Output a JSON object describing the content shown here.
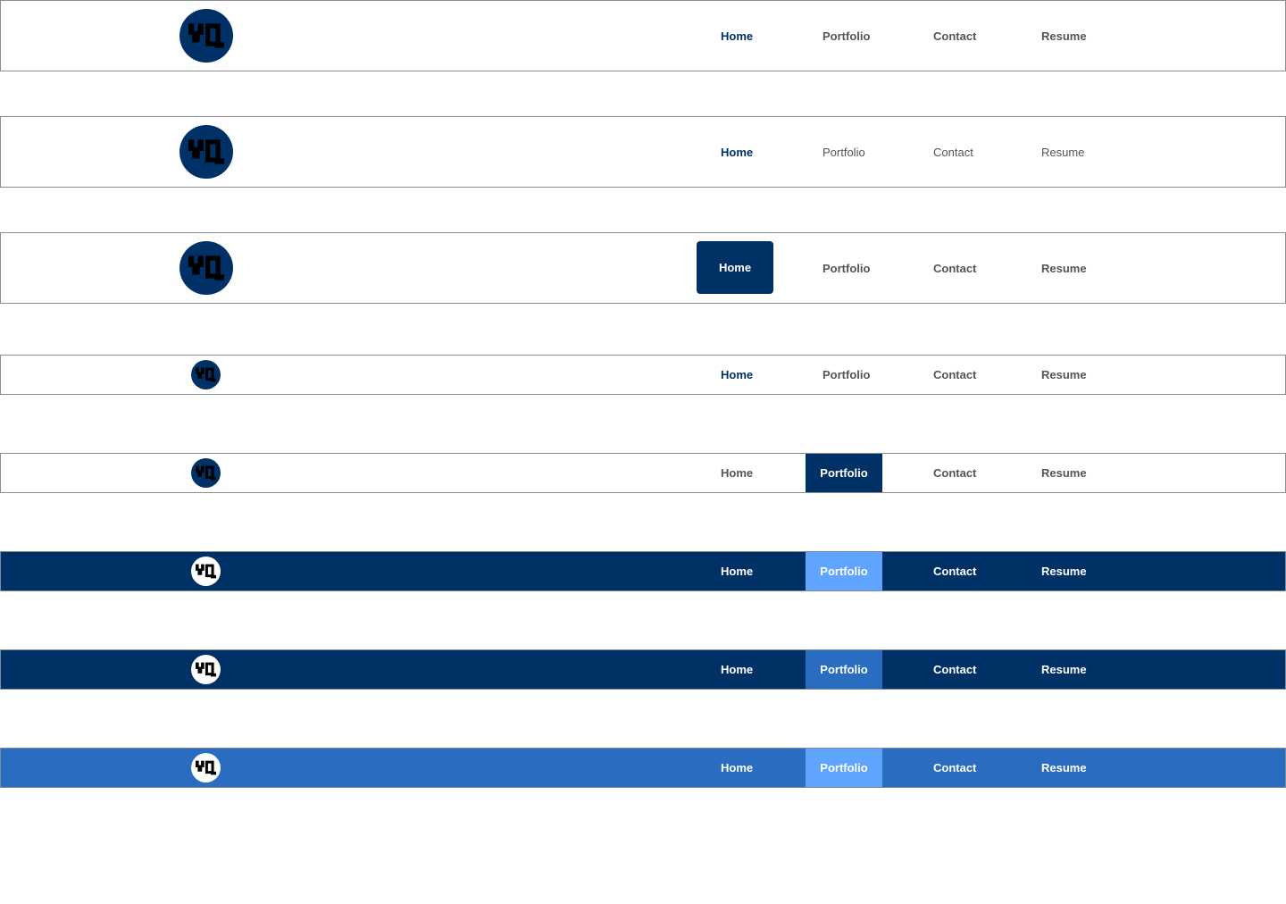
{
  "logo": {
    "icon": "yq-monogram-icon",
    "text": "YQ"
  },
  "nav": {
    "home": "Home",
    "portfolio": "Portfolio",
    "contact": "Contact",
    "resume": "Resume"
  },
  "variants": [
    {
      "name": "bold-links-home-active",
      "active": "Home",
      "background": "#ffffff"
    },
    {
      "name": "light-links-home-active",
      "active": "Home",
      "background": "#ffffff"
    },
    {
      "name": "pill-home-active",
      "active": "Home",
      "background": "#ffffff"
    },
    {
      "name": "compact-home-active",
      "active": "Home",
      "background": "#ffffff"
    },
    {
      "name": "compact-portfolio-tab",
      "active": "Portfolio",
      "background": "#ffffff"
    },
    {
      "name": "dark-portfolio-sky",
      "active": "Portfolio",
      "background": "#003166"
    },
    {
      "name": "dark-portfolio-mid",
      "active": "Portfolio",
      "background": "#003166"
    },
    {
      "name": "blue-portfolio-sky",
      "active": "Portfolio",
      "background": "#2a6cc0"
    }
  ],
  "colors": {
    "navy": "#003166",
    "blue": "#2a6cc0",
    "sky": "#5fa4ff",
    "muted_text": "#555555",
    "border": "#8c8c8c"
  }
}
